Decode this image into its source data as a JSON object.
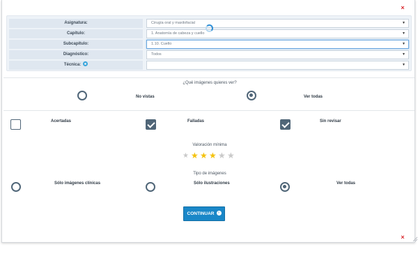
{
  "modal": {
    "close_symbol": "×"
  },
  "filters": {
    "rows": [
      {
        "label": "Asignatura:",
        "value": "Cirugía oral y maxilofacial",
        "caret": "▼"
      },
      {
        "label": "Capítulo:",
        "value": "1. Anatomía de cabeza y cuello",
        "caret": "▼"
      },
      {
        "label": "Subcapítulo:",
        "value": "1.10. Cuello",
        "caret": "▼"
      },
      {
        "label": "Diagnóstico:",
        "value": "Todos",
        "caret": "▼"
      },
      {
        "label": "Técnica:",
        "value": "",
        "caret": "▼"
      }
    ]
  },
  "images_question": {
    "title": "¿Qué imágenes quieres ver?",
    "options": [
      {
        "label": "No vistas",
        "checked": false
      },
      {
        "label": "Ver todas",
        "checked": true
      }
    ]
  },
  "answer_filter": {
    "options": [
      {
        "label": "Acertadas",
        "checked": false
      },
      {
        "label": "Falladas",
        "checked": true
      },
      {
        "label": "Sin revisar",
        "checked": true
      }
    ]
  },
  "rating": {
    "title": "Valoración mínima",
    "value": 3,
    "max": 5,
    "star_symbol": "★",
    "filled_color": "#f4c20d",
    "empty_color": "#c9c9c9"
  },
  "image_type": {
    "title": "Tipo de imágenes",
    "options": [
      {
        "label": "Sólo imágenes clínicas",
        "checked": false
      },
      {
        "label": "Sólo ilustraciones",
        "checked": false
      },
      {
        "label": "Ver todas",
        "checked": true
      }
    ]
  },
  "continue_button": {
    "label": "CONTINUAR",
    "icon": "›"
  },
  "colors": {
    "accent": "#1a87c8",
    "control": "#506678",
    "close": "#d9262c"
  }
}
